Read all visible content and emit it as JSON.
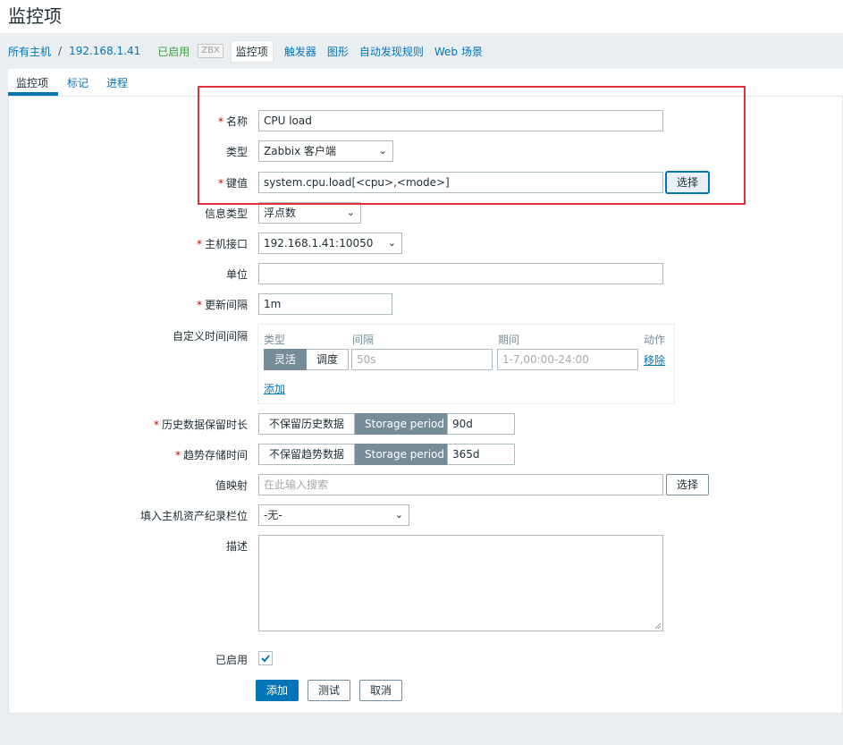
{
  "page": {
    "title": "监控项"
  },
  "breadcrumb": {
    "all_hosts": "所有主机",
    "separator": "/",
    "host": "192.168.1.41",
    "status": "已启用",
    "zbx": "ZBX",
    "tabs": [
      "监控项",
      "触发器",
      "图形",
      "自动发现规则",
      "Web 场景"
    ]
  },
  "tabs": [
    "监控项",
    "标记",
    "进程"
  ],
  "form": {
    "name": {
      "label": "名称",
      "value": "CPU load"
    },
    "type": {
      "label": "类型",
      "value": "Zabbix 客户端"
    },
    "key": {
      "label": "键值",
      "value": "system.cpu.load[<cpu>,<mode>]",
      "button": "选择"
    },
    "value_type": {
      "label": "信息类型",
      "value": "浮点数"
    },
    "interface": {
      "label": "主机接口",
      "value": "192.168.1.41:10050"
    },
    "units": {
      "label": "单位",
      "value": ""
    },
    "delay": {
      "label": "更新间隔",
      "value": "1m"
    },
    "custom_intervals": {
      "label": "自定义时间间隔",
      "headers": [
        "类型",
        "间隔",
        "期间",
        "动作"
      ],
      "row": {
        "type_options": [
          "灵活",
          "调度"
        ],
        "interval_placeholder": "50s",
        "period_placeholder": "1-7,00:00-24:00",
        "action": "移除"
      },
      "add": "添加"
    },
    "history": {
      "label": "历史数据保留时长",
      "options": [
        "不保留历史数据",
        "Storage period"
      ],
      "value": "90d"
    },
    "trends": {
      "label": "趋势存储时间",
      "options": [
        "不保留趋势数据",
        "Storage period"
      ],
      "value": "365d"
    },
    "valuemap": {
      "label": "值映射",
      "placeholder": "在此输入搜索",
      "button": "选择"
    },
    "inventory": {
      "label": "填入主机资产纪录栏位",
      "value": "-无-"
    },
    "description": {
      "label": "描述",
      "value": ""
    },
    "enabled": {
      "label": "已启用",
      "checked": true
    }
  },
  "actions": {
    "add": "添加",
    "test": "测试",
    "cancel": "取消"
  },
  "colors": {
    "accent": "#0275b8",
    "required": "#d40000",
    "highlight": "#e0323a",
    "enabled": "#429e47"
  }
}
